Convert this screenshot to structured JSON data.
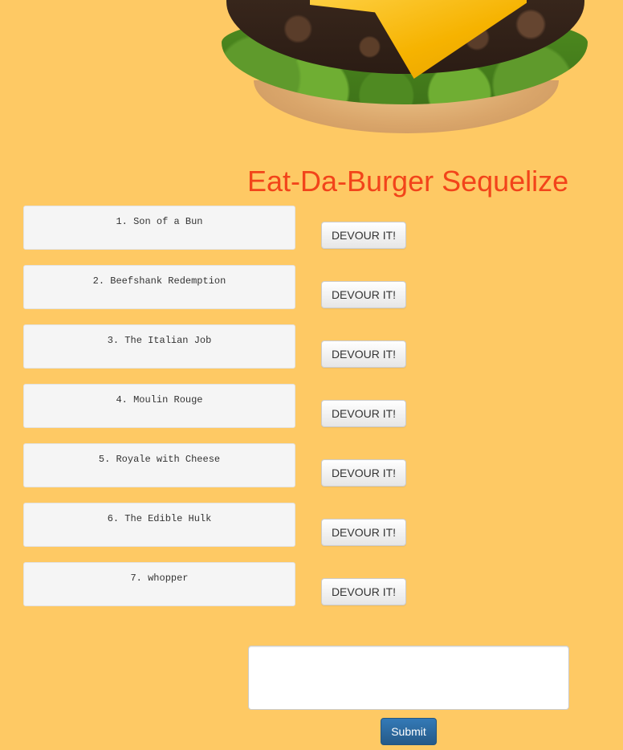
{
  "header": {
    "title": "Eat-Da-Burger Sequelize"
  },
  "burgers": [
    {
      "label": "1. Son of a Bun",
      "action_label": "DEVOUR IT!"
    },
    {
      "label": "2. Beefshank Redemption",
      "action_label": "DEVOUR IT!"
    },
    {
      "label": "3. The Italian Job",
      "action_label": "DEVOUR IT!"
    },
    {
      "label": "4. Moulin Rouge",
      "action_label": "DEVOUR IT!"
    },
    {
      "label": "5. Royale with Cheese",
      "action_label": "DEVOUR IT!"
    },
    {
      "label": "6. The Edible Hulk",
      "action_label": "DEVOUR IT!"
    },
    {
      "label": "7. whopper",
      "action_label": "DEVOUR IT!"
    }
  ],
  "form": {
    "input_value": "",
    "submit_label": "Submit"
  },
  "colors": {
    "background": "#fec964",
    "title": "#f2441a",
    "submit": "#337ab7"
  },
  "hero_image": {
    "icon": "burger-image"
  }
}
